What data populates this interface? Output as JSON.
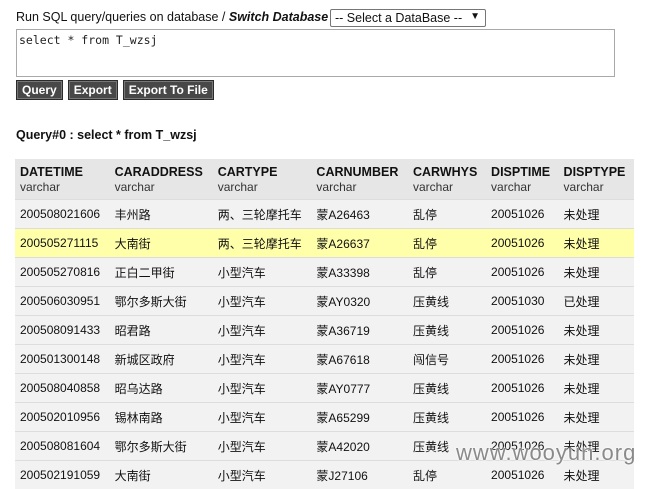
{
  "header": {
    "prompt": "Run SQL query/queries on database / ",
    "switch_label": "Switch Database :",
    "db_select_value": "-- Select a DataBase --"
  },
  "query_text": "select * from T_wzsj",
  "buttons": {
    "query": "Query",
    "export": "Export",
    "export_file": "Export To File"
  },
  "result_label": "Query#0 : select * from T_wzsj",
  "table": {
    "columns": [
      {
        "name": "DATETIME",
        "type": "varchar"
      },
      {
        "name": "CARADDRESS",
        "type": "varchar"
      },
      {
        "name": "CARTYPE",
        "type": "varchar"
      },
      {
        "name": "CARNUMBER",
        "type": "varchar"
      },
      {
        "name": "CARWHYS",
        "type": "varchar"
      },
      {
        "name": "DISPTIME",
        "type": "varchar"
      },
      {
        "name": "DISPTYPE",
        "type": "varchar"
      }
    ],
    "rows": [
      [
        "200508021606",
        "丰州路",
        "两、三轮摩托车",
        "蒙A26463",
        "乱停",
        "20051026",
        "未处理"
      ],
      [
        "200505271115",
        "大南街",
        "两、三轮摩托车",
        "蒙A26637",
        "乱停",
        "20051026",
        "未处理"
      ],
      [
        "200505270816",
        "正白二甲街",
        "小型汽车",
        "蒙A33398",
        "乱停",
        "20051026",
        "未处理"
      ],
      [
        "200506030951",
        "鄂尔多斯大街",
        "小型汽车",
        "蒙AY0320",
        "压黄线",
        "20051030",
        "已处理"
      ],
      [
        "200508091433",
        "昭君路",
        "小型汽车",
        "蒙A36719",
        "压黄线",
        "20051026",
        "未处理"
      ],
      [
        "200501300148",
        "新城区政府",
        "小型汽车",
        "蒙A67618",
        "闯信号",
        "20051026",
        "未处理"
      ],
      [
        "200508040858",
        "昭乌达路",
        "小型汽车",
        "蒙AY0777",
        "压黄线",
        "20051026",
        "未处理"
      ],
      [
        "200502010956",
        "锡林南路",
        "小型汽车",
        "蒙A65299",
        "压黄线",
        "20051026",
        "未处理"
      ],
      [
        "200508081604",
        "鄂尔多斯大街",
        "小型汽车",
        "蒙A42020",
        "压黄线",
        "20051026",
        "未处理"
      ],
      [
        "200502191059",
        "大南街",
        "小型汽车",
        "蒙J27106",
        "乱停",
        "20051026",
        "未处理"
      ]
    ],
    "highlighted_row": 1,
    "colors": {
      "header_bg": "#e6e6e6",
      "row_bg": "#f2f2f2",
      "highlight_bg": "#ffffaa"
    }
  },
  "watermark": "www.wooyun.org"
}
